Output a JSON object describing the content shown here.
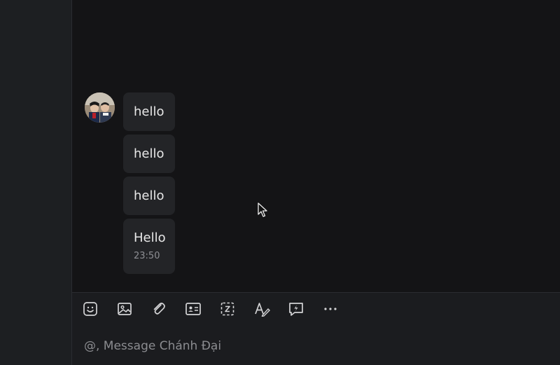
{
  "messages": [
    {
      "text": "hello"
    },
    {
      "text": "hello"
    },
    {
      "text": "hello"
    },
    {
      "text": "Hello",
      "time": "23:50"
    }
  ],
  "toolbar": {
    "icons": [
      "sticker-icon",
      "image-icon",
      "attachment-icon",
      "contact-card-icon",
      "screenshot-icon",
      "text-format-icon",
      "quick-message-icon",
      "more-icon"
    ]
  },
  "composer": {
    "placeholder": "@, Message Chánh Đại"
  },
  "colors": {
    "background": "#141416",
    "bubble": "#232427",
    "toolbar": "#1b1c1f",
    "icon": "#d4d4d6"
  }
}
